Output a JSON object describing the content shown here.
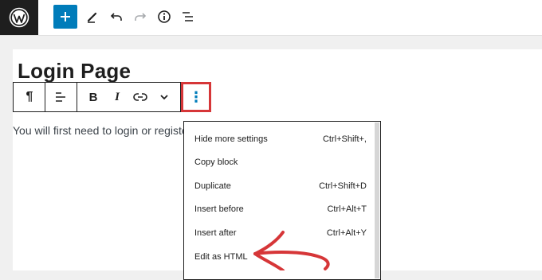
{
  "colors": {
    "accent": "#007cba",
    "highlight": "#d63638",
    "wp_bar": "#1e1e1e"
  },
  "topbar": {
    "icons": [
      "wordpress-logo",
      "add-block-icon",
      "tools-pencil-icon",
      "undo-icon",
      "redo-icon",
      "details-info-icon",
      "list-view-icon"
    ]
  },
  "editor": {
    "title": "Login Page",
    "paragraph": "You will first need to login or register"
  },
  "block_toolbar": {
    "buttons": [
      "paragraph-icon",
      "align-icon",
      "bold-icon",
      "italic-icon",
      "link-icon",
      "more-rich-text-chevron-icon",
      "options-kebab-icon"
    ],
    "bold": "B",
    "italic": "I",
    "paragraph_glyph": "¶",
    "kebab_glyph": "⋮"
  },
  "menu": {
    "items": [
      {
        "label": "Hide more settings",
        "shortcut": "Ctrl+Shift+,"
      },
      {
        "label": "Copy block",
        "shortcut": ""
      },
      {
        "label": "Duplicate",
        "shortcut": "Ctrl+Shift+D"
      },
      {
        "label": "Insert before",
        "shortcut": "Ctrl+Alt+T"
      },
      {
        "label": "Insert after",
        "shortcut": "Ctrl+Alt+Y"
      },
      {
        "label": "Edit as HTML",
        "shortcut": ""
      }
    ]
  }
}
